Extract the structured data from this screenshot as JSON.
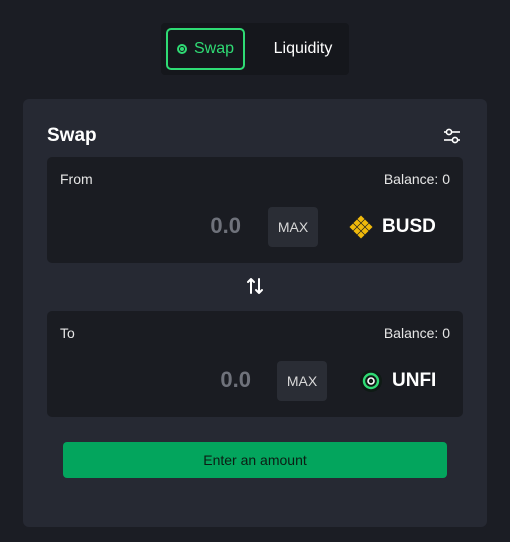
{
  "tabs": {
    "swap_label": "Swap",
    "liquidity_label": "Liquidity"
  },
  "card": {
    "title": "Swap"
  },
  "from": {
    "label": "From",
    "balance": "Balance: 0",
    "amount": "0.0",
    "max_label": "MAX",
    "token": "BUSD",
    "token_icon": "busd-icon"
  },
  "to": {
    "label": "To",
    "balance": "Balance: 0",
    "amount": "0.0",
    "max_label": "MAX",
    "token": "UNFI",
    "token_icon": "unfi-icon"
  },
  "submit": {
    "label": "Enter an amount"
  },
  "colors": {
    "accent": "#2fdb74",
    "button": "#03a55d",
    "background": "#1b1d24",
    "card": "#262933",
    "busd": "#f0b90b"
  }
}
